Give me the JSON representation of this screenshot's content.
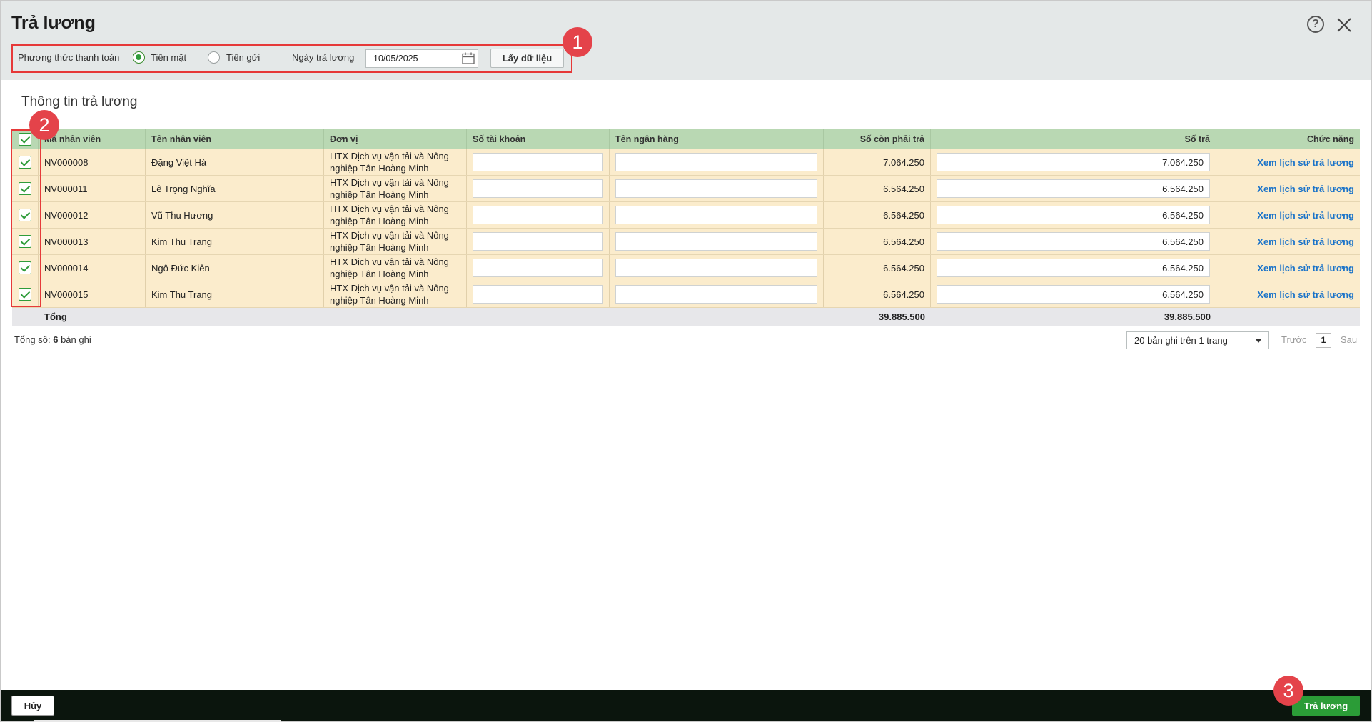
{
  "dialog": {
    "title": "Trả lương"
  },
  "filter": {
    "payment_method_label": "Phương thức thanh toán",
    "option_cash": "Tiền mặt",
    "option_deposit": "Tiền gửi",
    "selected": "Tiền mặt",
    "pay_date_label": "Ngày trả lương",
    "pay_date_value": "10/05/2025",
    "fetch_button": "Lấy dữ liệu"
  },
  "badges": [
    "1",
    "2",
    "3"
  ],
  "section": {
    "title": "Thông tin trả lương"
  },
  "table": {
    "columns": [
      "Mã nhân viên",
      "Tên nhân viên",
      "Đơn vị",
      "Số tài khoản",
      "Tên ngân hàng",
      "Số còn phải trả",
      "Số trả",
      "Chức năng"
    ],
    "rows": [
      {
        "code": "NV000008",
        "name": "Đặng Việt Hà",
        "unit": "HTX Dịch vụ vận tải và Nông nghiệp Tân Hoàng Minh",
        "account": "",
        "bank": "",
        "remaining": "7.064.250",
        "pay": "7.064.250",
        "action": "Xem lịch sử trả lương",
        "checked": true
      },
      {
        "code": "NV000011",
        "name": "Lê Trọng Nghĩa",
        "unit": "HTX Dịch vụ vận tải và Nông nghiệp Tân Hoàng Minh",
        "account": "",
        "bank": "",
        "remaining": "6.564.250",
        "pay": "6.564.250",
        "action": "Xem lịch sử trả lương",
        "checked": true
      },
      {
        "code": "NV000012",
        "name": "Vũ Thu Hương",
        "unit": "HTX Dịch vụ vận tải và Nông nghiệp Tân Hoàng Minh",
        "account": "",
        "bank": "",
        "remaining": "6.564.250",
        "pay": "6.564.250",
        "action": "Xem lịch sử trả lương",
        "checked": true
      },
      {
        "code": "NV000013",
        "name": "Kim Thu Trang",
        "unit": "HTX Dịch vụ vận tải và Nông nghiệp Tân Hoàng Minh",
        "account": "",
        "bank": "",
        "remaining": "6.564.250",
        "pay": "6.564.250",
        "action": "Xem lịch sử trả lương",
        "checked": true
      },
      {
        "code": "NV000014",
        "name": "Ngô Đức Kiên",
        "unit": "HTX Dịch vụ vận tải và Nông nghiệp Tân Hoàng Minh",
        "account": "",
        "bank": "",
        "remaining": "6.564.250",
        "pay": "6.564.250",
        "action": "Xem lịch sử trả lương",
        "checked": true
      },
      {
        "code": "NV000015",
        "name": "Kim Thu Trang",
        "unit": "HTX Dịch vụ vận tải và Nông nghiệp Tân Hoàng Minh",
        "account": "",
        "bank": "",
        "remaining": "6.564.250",
        "pay": "6.564.250",
        "action": "Xem lịch sử trả lương",
        "checked": true
      }
    ],
    "total": {
      "label": "Tổng",
      "remaining": "39.885.500",
      "pay": "39.885.500"
    }
  },
  "pagination": {
    "total_prefix": "Tổng số:",
    "total_count": "6",
    "total_suffix": "bản ghi",
    "page_size": "20 bản ghi trên 1 trang",
    "prev": "Trước",
    "current": "1",
    "next": "Sau"
  },
  "footer": {
    "cancel": "Hủy",
    "pay": "Trả lương"
  },
  "colors": {
    "accent": "#2b9c37",
    "header_row": "#b9d8b3",
    "data_row": "#fbeccc",
    "annotation": "#e63939",
    "link": "#1a73c9"
  }
}
